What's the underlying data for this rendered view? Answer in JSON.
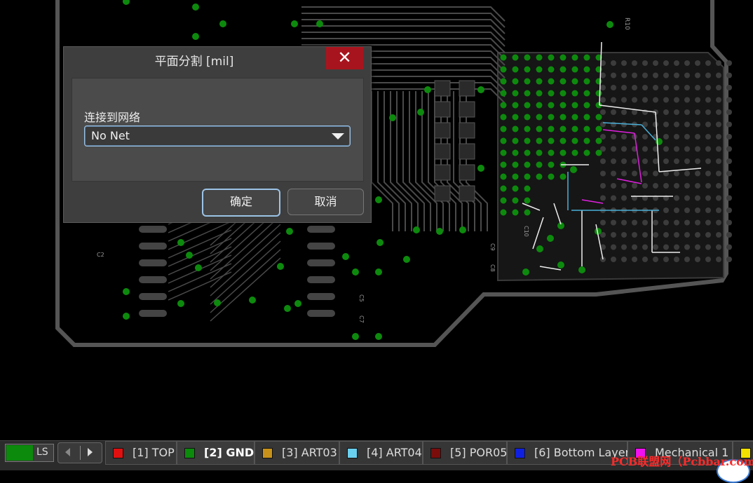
{
  "dialog": {
    "title": "平面分割 [mil]",
    "close_icon": "close-icon",
    "net_label": "连接到网络",
    "net_value": "No Net",
    "ok_label": "确定",
    "cancel_label": "取消"
  },
  "layerbar": {
    "ls_label": "LS",
    "ls_color": "#0b8a0b",
    "tabs": [
      {
        "label": "[1] TOP",
        "color": "#e01010"
      },
      {
        "label": "[2] GND",
        "color": "#0b8a0b"
      },
      {
        "label": "[3] ART03",
        "color": "#c8921a"
      },
      {
        "label": "[4] ART04",
        "color": "#6ad0ef"
      },
      {
        "label": "[5] POR05",
        "color": "#7a0c0c"
      },
      {
        "label": "[6] Bottom Layer",
        "color": "#1020e0"
      },
      {
        "label": "Mechanical 1",
        "color": "#f010f0"
      },
      {
        "label": "",
        "color": "#f2e000"
      }
    ]
  },
  "pcb": {
    "silkscreen_labels": [
      "R10",
      "C10",
      "C2",
      "C5",
      "C7",
      "C9",
      "C8"
    ]
  },
  "watermark": "PCB联盟网（Pcbbar.com）",
  "colors": {
    "board_bg": "#000000",
    "via": "#0d8a0d",
    "trace": "#4a4a4a",
    "dialog_bg": "#3e3e3e",
    "close_red": "#a8141d",
    "focus_blue": "#9cc3e6"
  }
}
